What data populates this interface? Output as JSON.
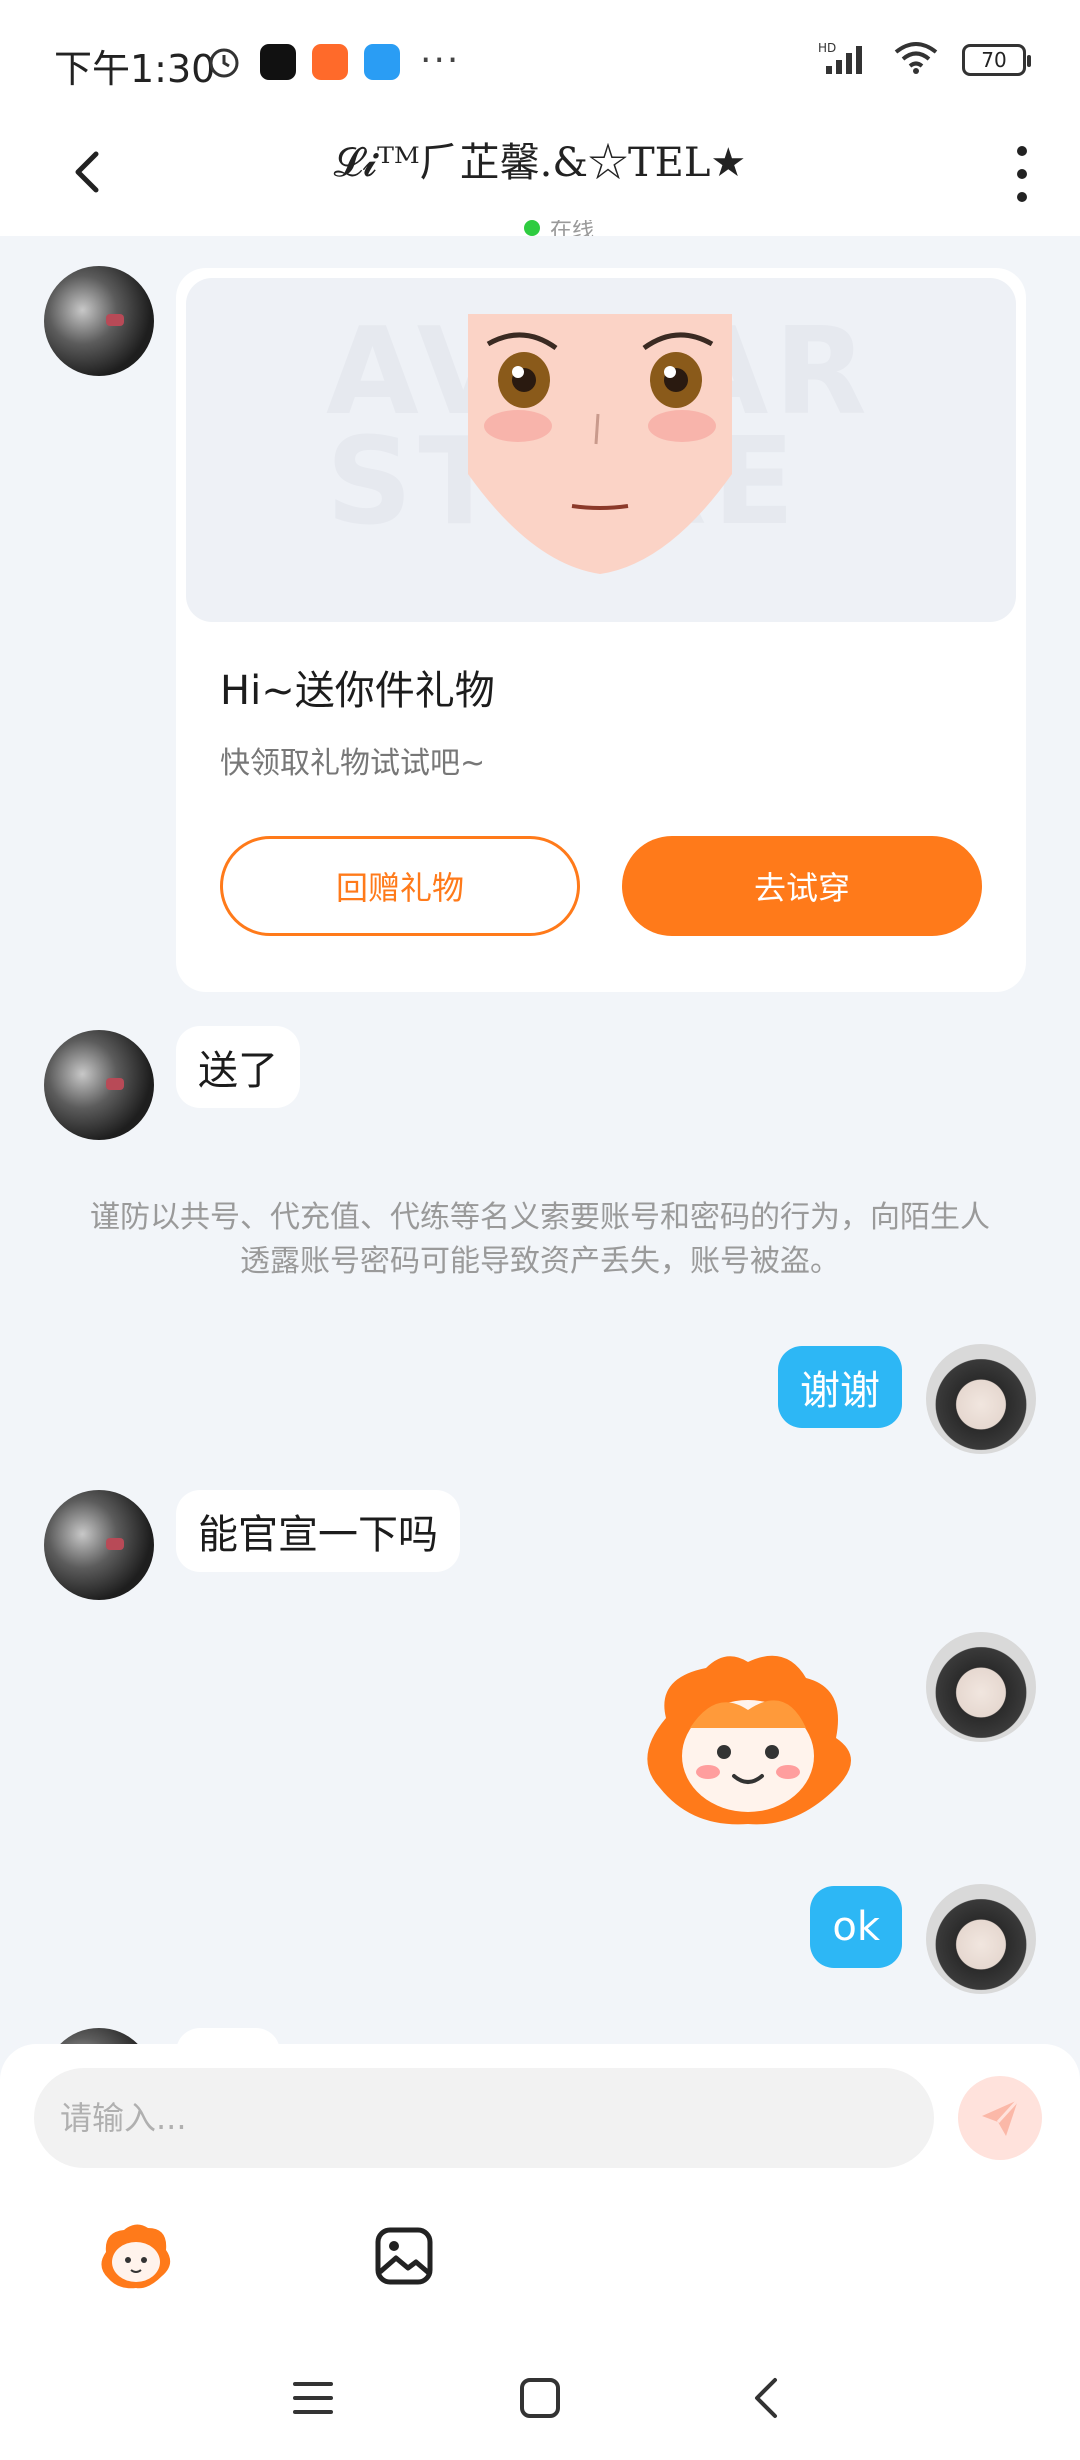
{
  "status_bar": {
    "time": "下午1:30",
    "more": "···",
    "network": "HD",
    "battery": "70"
  },
  "header": {
    "title": "𝓛𝓲ᵀᴹ⺁芷馨.&☆TEL★",
    "online": "在线"
  },
  "gift_card": {
    "watermark": "AVATAR STORE",
    "title": "Hi~送你件礼物",
    "subtitle": "快领取礼物试试吧~",
    "return_gift_label": "回赠礼物",
    "try_on_label": "去试穿"
  },
  "messages": {
    "m1": "送了",
    "notice": "谨防以共号、代充值、代练等名义索要账号和密码的行为，向陌生人透露账号密码可能导致资产丢失，账号被盗。",
    "m2": "谢谢",
    "m3": "能官宣一下吗",
    "m4": "ok"
  },
  "composer": {
    "placeholder": "请输入..."
  },
  "icons": {
    "back": "back-arrow-icon",
    "more": "more-vertical-icon",
    "send": "send-icon",
    "sticker": "sticker-icon",
    "image": "image-icon",
    "nav_menu": "menu-icon",
    "nav_home": "home-square-icon",
    "nav_back": "nav-back-icon"
  },
  "colors": {
    "accent": "#ff7a1a",
    "outgoing_bubble": "#2db7f5",
    "online": "#2ecc40",
    "background": "#f2f5f9"
  }
}
